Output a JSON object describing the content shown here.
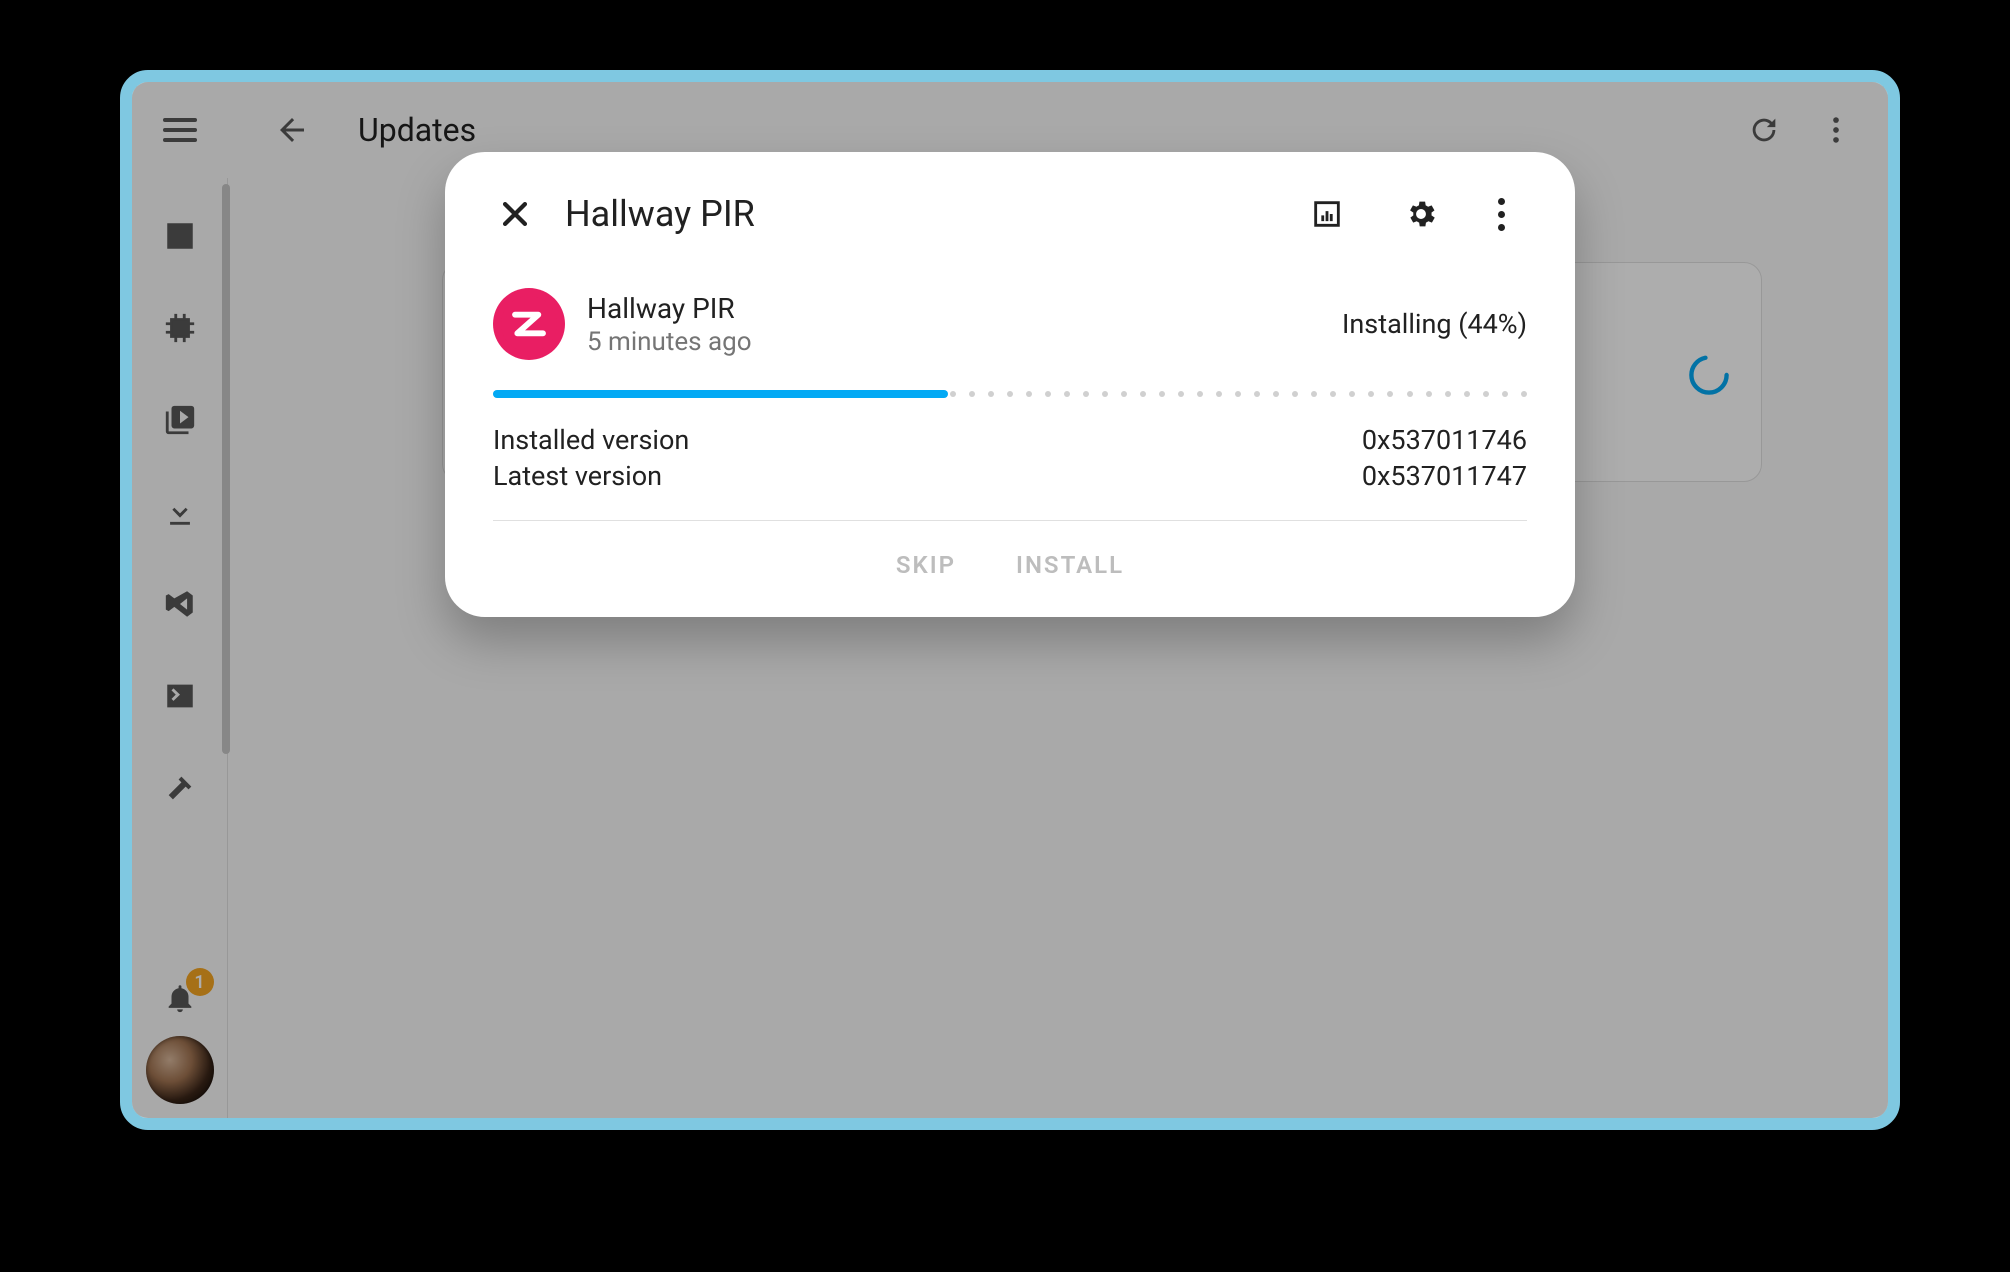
{
  "header": {
    "title": "Updates"
  },
  "sidebar": {
    "notification_count": "1"
  },
  "dialog": {
    "title": "Hallway PIR",
    "device_name": "Hallway PIR",
    "device_time": "5 minutes ago",
    "status": "Installing (44%)",
    "progress_percent": 44,
    "installed_version_label": "Installed version",
    "installed_version_value": "0x537011746",
    "latest_version_label": "Latest version",
    "latest_version_value": "0x537011747",
    "skip_label": "SKIP",
    "install_label": "INSTALL"
  }
}
